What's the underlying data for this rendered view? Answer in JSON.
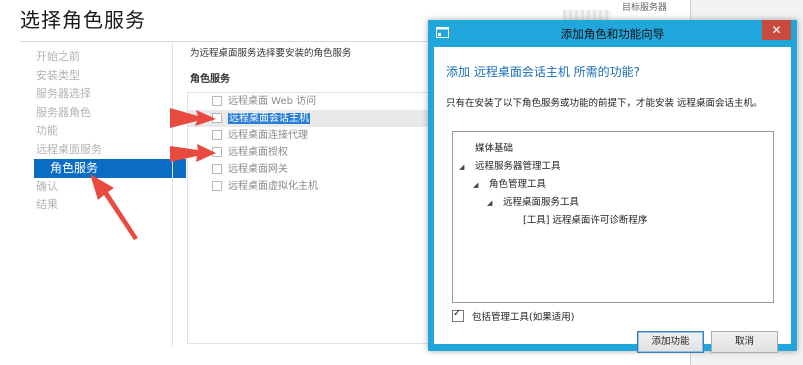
{
  "page": {
    "title": "选择角色服务",
    "top_right_text": "目标服务器"
  },
  "nav": {
    "items": [
      {
        "label": "开始之前",
        "state": "disabled"
      },
      {
        "label": "安装类型",
        "state": "disabled"
      },
      {
        "label": "服务器选择",
        "state": "disabled"
      },
      {
        "label": "服务器角色",
        "state": "disabled"
      },
      {
        "label": "功能",
        "state": "disabled"
      },
      {
        "label": "远程桌面服务",
        "state": "disabled"
      },
      {
        "label": "角色服务",
        "state": "active"
      },
      {
        "label": "确认",
        "state": "disabled"
      },
      {
        "label": "结果",
        "state": "disabled"
      }
    ]
  },
  "main": {
    "description": "为远程桌面服务选择要安装的角色服务",
    "roles_header": "角色服务",
    "roles": [
      {
        "label": "远程桌面 Web 访问",
        "selected": false
      },
      {
        "label": "远程桌面会话主机",
        "selected": true
      },
      {
        "label": "远程桌面连接代理",
        "selected": false
      },
      {
        "label": "远程桌面授权",
        "selected": false
      },
      {
        "label": "远程桌面网关",
        "selected": false
      },
      {
        "label": "远程桌面虚拟化主机",
        "selected": false
      }
    ]
  },
  "dialog": {
    "title": "添加角色和功能向导",
    "close_symbol": "✕",
    "heading": "添加 远程桌面会话主机 所需的功能?",
    "description": "只有在安装了以下角色服务或功能的前提下，才能安装 远程桌面会话主机。",
    "tree": [
      {
        "label": "媒体基础",
        "level": 0,
        "expandable": false
      },
      {
        "label": "远程服务器管理工具",
        "level": 0,
        "expandable": true
      },
      {
        "label": "角色管理工具",
        "level": 1,
        "expandable": true
      },
      {
        "label": "远程桌面服务工具",
        "level": 2,
        "expandable": true
      },
      {
        "label": "[工具] 远程桌面许可诊断程序",
        "level": 3,
        "expandable": false
      }
    ],
    "include_tools_label": "包括管理工具(如果适用)",
    "include_tools_checked": true,
    "add_button": "添加功能",
    "cancel_button": "取消"
  },
  "colors": {
    "accent": "#0b6cc3",
    "dialog_frame": "#20a6da",
    "close_button": "#c84a3c",
    "annotation_arrow": "#e84a3f"
  }
}
